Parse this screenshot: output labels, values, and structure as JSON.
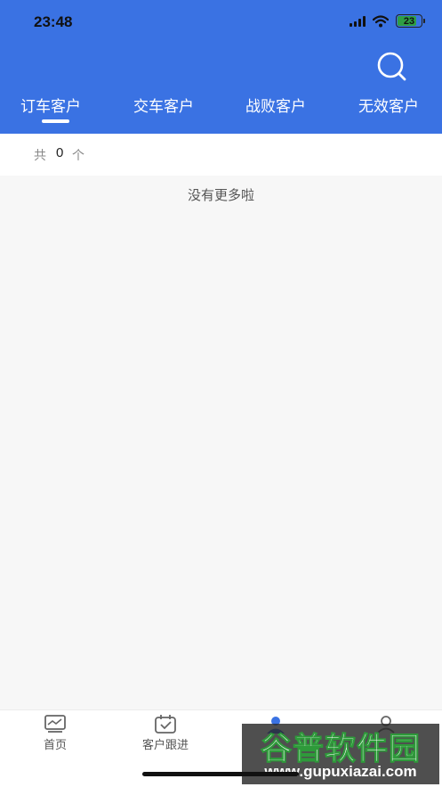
{
  "status_bar": {
    "time": "23:48",
    "battery": "23",
    "icons": [
      "signal-icon",
      "wifi-icon",
      "battery-icon"
    ]
  },
  "header": {
    "search_icon": "search-icon"
  },
  "tabs": [
    {
      "label": "订车客户",
      "active": true
    },
    {
      "label": "交车客户",
      "active": false
    },
    {
      "label": "战败客户",
      "active": false
    },
    {
      "label": "无效客户",
      "active": false
    }
  ],
  "summary": {
    "prefix": "共",
    "count": "0",
    "suffix": "个"
  },
  "list": {
    "empty_text": "没有更多啦"
  },
  "tabbar": {
    "items": [
      {
        "label": "首页",
        "icon": "dashboard-icon"
      },
      {
        "label": "客户跟进",
        "icon": "calendar-check-icon"
      },
      {
        "label": "",
        "icon": "person-icon"
      },
      {
        "label": "",
        "icon": "profile-icon"
      }
    ]
  },
  "watermark": {
    "title": "谷普软件园",
    "url": "www.gupuxiazai.com"
  },
  "colors": {
    "primary": "#3a72e3",
    "background": "#f7f7f7",
    "watermark_green": "#2e9a3a"
  }
}
